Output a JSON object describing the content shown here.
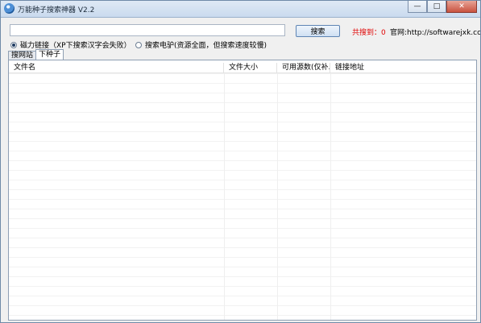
{
  "window": {
    "title": "万能种子搜索神器 V2.2",
    "controls": {
      "minimize": "—",
      "maximize": "□",
      "close": "✕"
    }
  },
  "toolbar": {
    "search_value": "",
    "search_button": "搜索",
    "found_label": "共搜到：0",
    "site_label": "官网:http://softwarejxk.com"
  },
  "options": [
    {
      "label": "磁力链接（XP下搜索汉字会失败）",
      "checked": true
    },
    {
      "label": "搜索电驴(资源全面，但搜索速度较慢)",
      "checked": false
    }
  ],
  "tabs": [
    {
      "label": "搜网站",
      "active": false
    },
    {
      "label": "下种子",
      "active": true
    }
  ],
  "table": {
    "columns": [
      "文件名",
      "文件大小",
      "可用源数(仅补...",
      "链接地址"
    ]
  }
}
